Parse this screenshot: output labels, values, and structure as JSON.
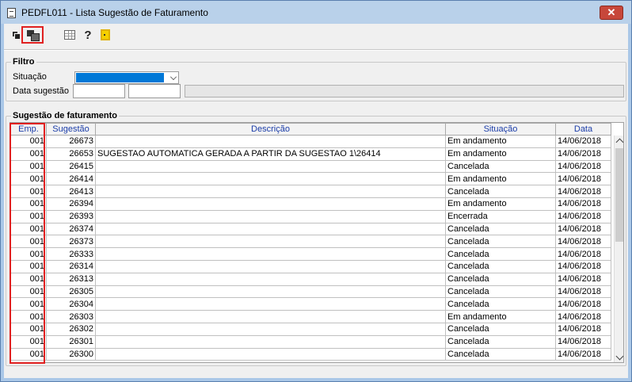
{
  "window": {
    "title": "PEDFL011 - Lista Sugestão de Faturamento",
    "close_label": "✕"
  },
  "toolbar": {
    "buttons": [
      "select-icon",
      "export-icon",
      "grid-icon",
      "help-icon",
      "exit-icon"
    ],
    "help_glyph": "?"
  },
  "filter": {
    "legend": "Filtro",
    "situacao_label": "Situação",
    "situacao_selected": "",
    "data_label": "Data sugestão",
    "data_from": "",
    "data_to": ""
  },
  "list": {
    "legend": "Sugestão de faturamento",
    "columns": [
      "Emp.",
      "Sugestão",
      "Descrição",
      "Situação",
      "Data"
    ],
    "rows": [
      {
        "emp": "001",
        "sugestao": "26673",
        "descricao": "",
        "situacao": "Em andamento",
        "data": "14/06/2018"
      },
      {
        "emp": "001",
        "sugestao": "26653",
        "descricao": "SUGESTAO AUTOMATICA GERADA A PARTIR DA SUGESTAO 1\\26414",
        "situacao": "Em andamento",
        "data": "14/06/2018"
      },
      {
        "emp": "001",
        "sugestao": "26415",
        "descricao": "",
        "situacao": "Cancelada",
        "data": "14/06/2018"
      },
      {
        "emp": "001",
        "sugestao": "26414",
        "descricao": "",
        "situacao": "Em andamento",
        "data": "14/06/2018"
      },
      {
        "emp": "001",
        "sugestao": "26413",
        "descricao": "",
        "situacao": "Cancelada",
        "data": "14/06/2018"
      },
      {
        "emp": "001",
        "sugestao": "26394",
        "descricao": "",
        "situacao": "Em andamento",
        "data": "14/06/2018"
      },
      {
        "emp": "001",
        "sugestao": "26393",
        "descricao": "",
        "situacao": "Encerrada",
        "data": "14/06/2018"
      },
      {
        "emp": "001",
        "sugestao": "26374",
        "descricao": "",
        "situacao": "Cancelada",
        "data": "14/06/2018"
      },
      {
        "emp": "001",
        "sugestao": "26373",
        "descricao": "",
        "situacao": "Cancelada",
        "data": "14/06/2018"
      },
      {
        "emp": "001",
        "sugestao": "26333",
        "descricao": "",
        "situacao": "Cancelada",
        "data": "14/06/2018"
      },
      {
        "emp": "001",
        "sugestao": "26314",
        "descricao": "",
        "situacao": "Cancelada",
        "data": "14/06/2018"
      },
      {
        "emp": "001",
        "sugestao": "26313",
        "descricao": "",
        "situacao": "Cancelada",
        "data": "14/06/2018"
      },
      {
        "emp": "001",
        "sugestao": "26305",
        "descricao": "",
        "situacao": "Cancelada",
        "data": "14/06/2018"
      },
      {
        "emp": "001",
        "sugestao": "26304",
        "descricao": "",
        "situacao": "Cancelada",
        "data": "14/06/2018"
      },
      {
        "emp": "001",
        "sugestao": "26303",
        "descricao": "",
        "situacao": "Em andamento",
        "data": "14/06/2018"
      },
      {
        "emp": "001",
        "sugestao": "26302",
        "descricao": "",
        "situacao": "Cancelada",
        "data": "14/06/2018"
      },
      {
        "emp": "001",
        "sugestao": "26301",
        "descricao": "",
        "situacao": "Cancelada",
        "data": "14/06/2018"
      },
      {
        "emp": "001",
        "sugestao": "26300",
        "descricao": "",
        "situacao": "Cancelada",
        "data": "14/06/2018"
      }
    ]
  },
  "colors": {
    "title_bg": "#b9d1ea",
    "header_text": "#1a3ca8",
    "highlight_red": "#e02020",
    "combo_selection": "#0078d7"
  }
}
